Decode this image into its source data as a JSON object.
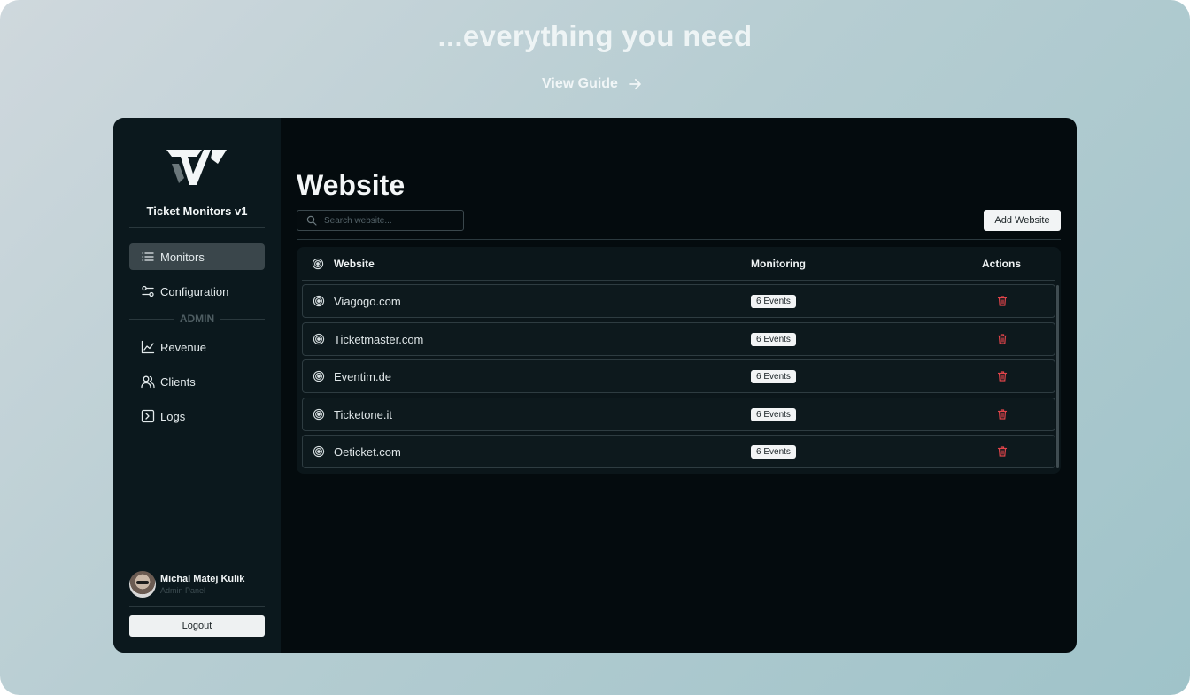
{
  "hero": {
    "title": "...everything you need",
    "guide_label": "View Guide"
  },
  "sidebar": {
    "app_name": "Ticket Monitors v1",
    "nav": [
      {
        "label": "Monitors",
        "icon": "list-icon",
        "active": true
      },
      {
        "label": "Configuration",
        "icon": "sliders-icon",
        "active": false
      }
    ],
    "admin_label": "ADMIN",
    "admin_nav": [
      {
        "label": "Revenue",
        "icon": "chart-line-icon"
      },
      {
        "label": "Clients",
        "icon": "users-icon"
      },
      {
        "label": "Logs",
        "icon": "terminal-icon"
      }
    ],
    "user": {
      "name": "Michal Matej Kulík",
      "role": "Admin Panel"
    },
    "logout_label": "Logout"
  },
  "main": {
    "title": "Website",
    "search_placeholder": "Search website...",
    "add_button_label": "Add Website",
    "table": {
      "headers": {
        "website": "Website",
        "monitoring": "Monitoring",
        "actions": "Actions"
      },
      "rows": [
        {
          "website": "Viagogo.com",
          "monitoring": "6 Events"
        },
        {
          "website": "Ticketmaster.com",
          "monitoring": "6 Events"
        },
        {
          "website": "Eventim.de",
          "monitoring": "6 Events"
        },
        {
          "website": "Ticketone.it",
          "monitoring": "6 Events"
        },
        {
          "website": "Oeticket.com",
          "monitoring": "6 Events"
        }
      ]
    }
  },
  "colors": {
    "accent_delete": "#e0444a",
    "app_bg": "#040b0e",
    "sidebar_bg": "#0b181d"
  }
}
